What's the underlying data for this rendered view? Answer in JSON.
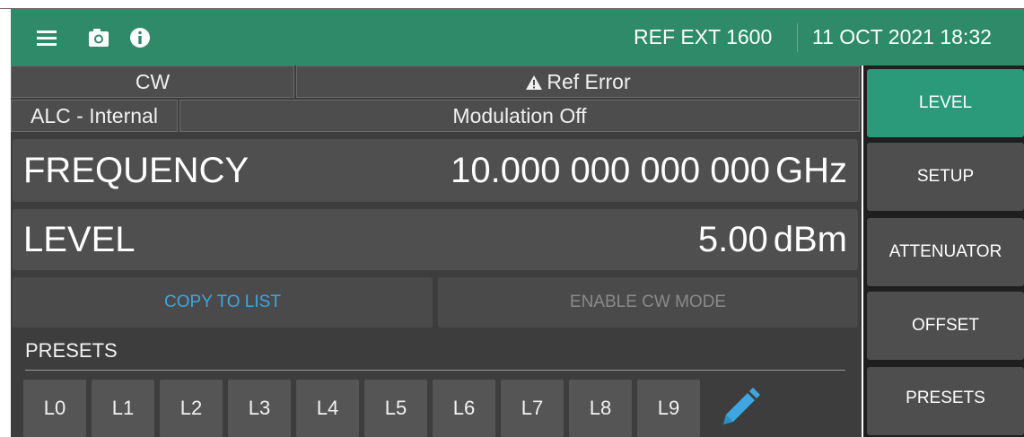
{
  "header": {
    "reference": "REF EXT 1600",
    "datetime": "11 OCT 2021 18:32",
    "icons": [
      "menu-icon",
      "camera-icon",
      "info-icon"
    ]
  },
  "status": {
    "mode": "CW",
    "ref_error": "Ref Error",
    "alc": "ALC - Internal",
    "modulation": "Modulation Off"
  },
  "frequency": {
    "label": "FREQUENCY",
    "value": "10.000 000 000 000",
    "unit": "GHz"
  },
  "level": {
    "label": "LEVEL",
    "value": "5.00",
    "unit": "dBm"
  },
  "actions": {
    "copy_to_list": "COPY TO LIST",
    "enable_cw_mode": "ENABLE CW MODE"
  },
  "presets": {
    "title": "PRESETS",
    "items": [
      "L0",
      "L1",
      "L2",
      "L3",
      "L4",
      "L5",
      "L6",
      "L7",
      "L8",
      "L9"
    ]
  },
  "sidebar": {
    "items": [
      {
        "label": "LEVEL",
        "active": true
      },
      {
        "label": "SETUP",
        "active": false
      },
      {
        "label": "ATTENUATOR",
        "active": false
      },
      {
        "label": "OFFSET",
        "active": false
      },
      {
        "label": "PRESETS",
        "active": false
      }
    ]
  },
  "colors": {
    "header": "#2e8a68",
    "active_tab": "#2b9a7a",
    "copy_link": "#3ea6e0",
    "disabled_text": "#8a8a8a",
    "pencil": "#3ea6e0"
  }
}
